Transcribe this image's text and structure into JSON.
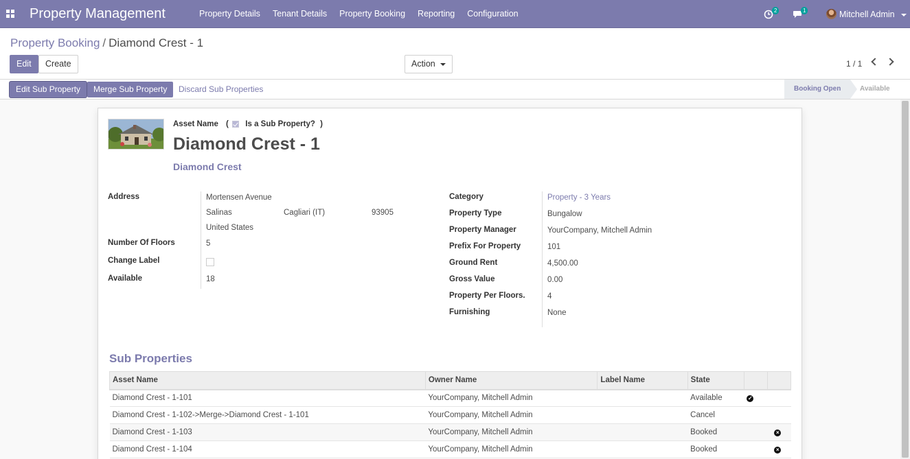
{
  "navbar": {
    "app_title": "Property Management",
    "menu": [
      "Property Details",
      "Tenant Details",
      "Property Booking",
      "Reporting",
      "Configuration"
    ],
    "activity_count": "2",
    "message_count": "1",
    "user_name": "Mitchell Admin"
  },
  "control_panel": {
    "breadcrumb_parent": "Property Booking",
    "breadcrumb_separator": "/",
    "breadcrumb_current": "Diamond Crest - 1",
    "edit_label": "Edit",
    "create_label": "Create",
    "action_label": "Action",
    "pager": "1 / 1"
  },
  "statusbar": {
    "edit_sub_label": "Edit Sub Property",
    "merge_sub_label": "Merge Sub Property",
    "discard_sub_label": "Discard Sub Properties",
    "stages": [
      "Booking Open",
      "Available"
    ]
  },
  "form": {
    "asset_name_label": "Asset Name",
    "open_paren": "(",
    "is_sub_property_label": "Is a Sub Property?",
    "close_paren": ")",
    "record_name": "Diamond Crest - 1",
    "parent_property": "Diamond Crest",
    "left_fields": {
      "address_label": "Address",
      "street": "Mortensen Avenue",
      "city": "Salinas",
      "state": "Cagliari (IT)",
      "zip": "93905",
      "country": "United States",
      "floors_label": "Number Of Floors",
      "floors_value": "5",
      "change_label_label": "Change Label",
      "available_label": "Available",
      "available_value": "18"
    },
    "right_fields": [
      {
        "label": "Category",
        "value": "Property - 3 Years"
      },
      {
        "label": "Property Type",
        "value": "Bungalow"
      },
      {
        "label": "Property Manager",
        "value": "YourCompany, Mitchell Admin"
      },
      {
        "label": "Prefix For Property",
        "value": "101"
      },
      {
        "label": "Ground Rent",
        "value": "4,500.00"
      },
      {
        "label": "Gross Value",
        "value": "0.00"
      },
      {
        "label": "Property Per Floors.",
        "value": "4"
      },
      {
        "label": "Furnishing",
        "value": "None"
      }
    ]
  },
  "sub_properties": {
    "title": "Sub Properties",
    "columns": [
      "Asset Name",
      "Owner Name",
      "Label Name",
      "State"
    ],
    "rows": [
      {
        "asset": "Diamond Crest - 1-101",
        "owner": "YourCompany, Mitchell Admin",
        "label": "",
        "state": "Available",
        "icon": "check-circle-icon"
      },
      {
        "asset": "Diamond Crest - 1-102->Merge->Diamond Crest - 1-101",
        "owner": "YourCompany, Mitchell Admin",
        "label": "",
        "state": "Cancel",
        "icon": ""
      },
      {
        "asset": "Diamond Crest - 1-103",
        "owner": "YourCompany, Mitchell Admin",
        "label": "",
        "state": "Booked",
        "icon": "times-circle-icon"
      },
      {
        "asset": "Diamond Crest - 1-104",
        "owner": "YourCompany, Mitchell Admin",
        "label": "",
        "state": "Booked",
        "icon": "times-circle-icon"
      }
    ]
  },
  "colors": {
    "brand": "#7c7bad",
    "badge": "#00a09d"
  }
}
